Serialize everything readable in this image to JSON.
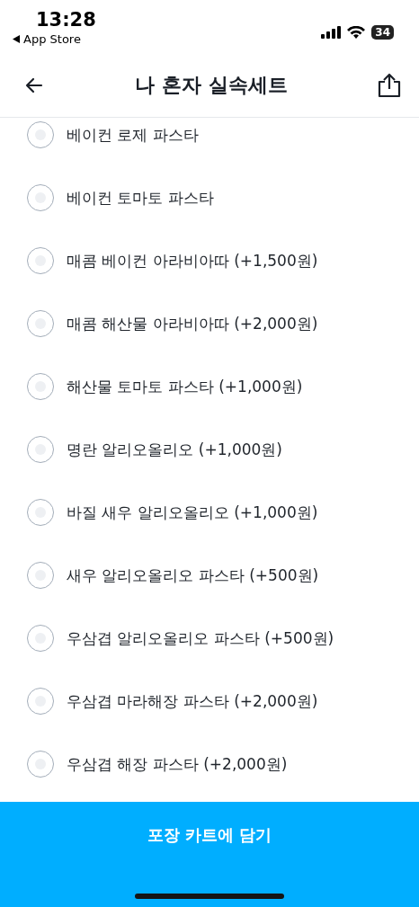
{
  "status_bar": {
    "time": "13:28",
    "back_label": "App Store",
    "battery": "34"
  },
  "header": {
    "title": "나 혼자 실속세트"
  },
  "options": [
    {
      "label": "베이컨 로제 파스타",
      "selected": false
    },
    {
      "label": "베이컨 토마토 파스타",
      "selected": false
    },
    {
      "label": "매콤 베이컨 아라비아따 (+1,500원)",
      "selected": false
    },
    {
      "label": "매콤 해산물 아라비아따 (+2,000원)",
      "selected": false
    },
    {
      "label": "해산물 토마토 파스타 (+1,000원)",
      "selected": false
    },
    {
      "label": "명란 알리오올리오 (+1,000원)",
      "selected": false
    },
    {
      "label": "바질 새우 알리오올리오 (+1,000원)",
      "selected": false
    },
    {
      "label": "새우 알리오올리오 파스타 (+500원)",
      "selected": false
    },
    {
      "label": "우삼겹 알리오올리오 파스타 (+500원)",
      "selected": false
    },
    {
      "label": "우삼겹 마라해장 파스타 (+2,000원)",
      "selected": false
    },
    {
      "label": "우삼겹 해장 파스타 (+2,000원)",
      "selected": false
    }
  ],
  "cta": {
    "label": "포장 카트에 담기"
  }
}
